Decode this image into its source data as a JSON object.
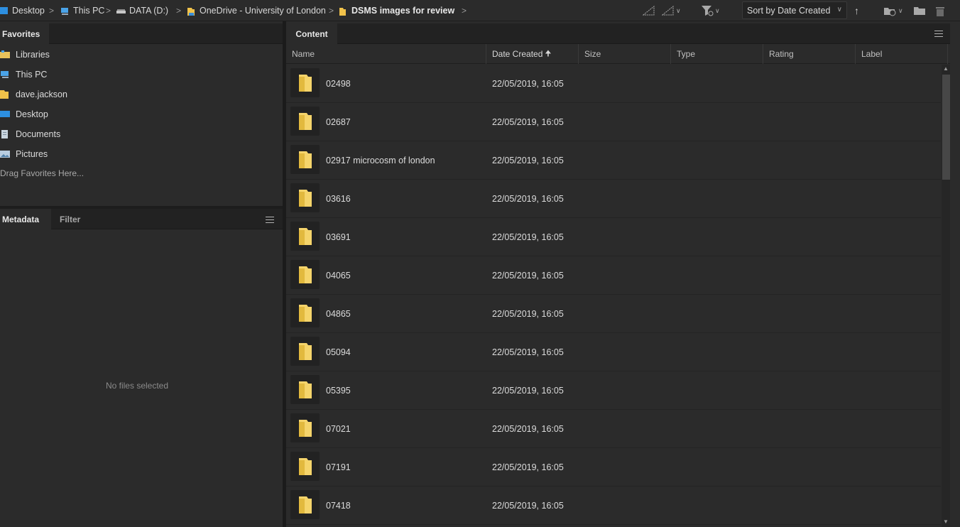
{
  "breadcrumb": {
    "items": [
      {
        "label": "Desktop",
        "icon": "desktop-icon"
      },
      {
        "label": "This PC",
        "icon": "this-pc-icon"
      },
      {
        "label": "DATA (D:)",
        "icon": "drive-icon"
      },
      {
        "label": "OneDrive - University of London",
        "icon": "folder-icon"
      },
      {
        "label": "DSMS images for review",
        "icon": "folder-icon"
      }
    ],
    "separator": ">"
  },
  "toolbar": {
    "sort_label": "Sort by Date Created",
    "sort_direction": "ascending",
    "icons": [
      "quality-filter-icon",
      "quality-filter-dropdown-icon",
      "filter-items-icon",
      "open-recent-icon",
      "new-folder-icon",
      "delete-icon"
    ]
  },
  "favorites_panel": {
    "tab_label": "Favorites",
    "items": [
      {
        "label": "Libraries",
        "icon": "libraries-icon"
      },
      {
        "label": "This PC",
        "icon": "this-pc-icon"
      },
      {
        "label": "dave.jackson",
        "icon": "user-folder-icon"
      },
      {
        "label": "Desktop",
        "icon": "desktop-icon"
      },
      {
        "label": "Documents",
        "icon": "documents-icon"
      },
      {
        "label": "Pictures",
        "icon": "pictures-icon"
      }
    ],
    "drag_hint": "Drag Favorites Here..."
  },
  "metadata_panel": {
    "tabs": [
      "Metadata",
      "Filter"
    ],
    "empty_text": "No files selected"
  },
  "content_panel": {
    "tab_label": "Content",
    "columns": [
      "Name",
      "Date Created",
      "Size",
      "Type",
      "Rating",
      "Label"
    ],
    "sorted_column": "Date Created",
    "rows": [
      {
        "name": "02498",
        "date": "22/05/2019, 16:05"
      },
      {
        "name": "02687",
        "date": "22/05/2019, 16:05"
      },
      {
        "name": "02917 microcosm of london",
        "date": "22/05/2019, 16:05"
      },
      {
        "name": "03616",
        "date": "22/05/2019, 16:05"
      },
      {
        "name": "03691",
        "date": "22/05/2019, 16:05"
      },
      {
        "name": "04065",
        "date": "22/05/2019, 16:05"
      },
      {
        "name": "04865",
        "date": "22/05/2019, 16:05"
      },
      {
        "name": "05094",
        "date": "22/05/2019, 16:05"
      },
      {
        "name": "05395",
        "date": "22/05/2019, 16:05"
      },
      {
        "name": "07021",
        "date": "22/05/2019, 16:05"
      },
      {
        "name": "07191",
        "date": "22/05/2019, 16:05"
      },
      {
        "name": "07418",
        "date": "22/05/2019, 16:05"
      }
    ]
  },
  "colors": {
    "background": "#2b2b2b",
    "panel_header": "#222222",
    "folder_yellow": "#f5d46b",
    "text": "#dcdcdc"
  }
}
